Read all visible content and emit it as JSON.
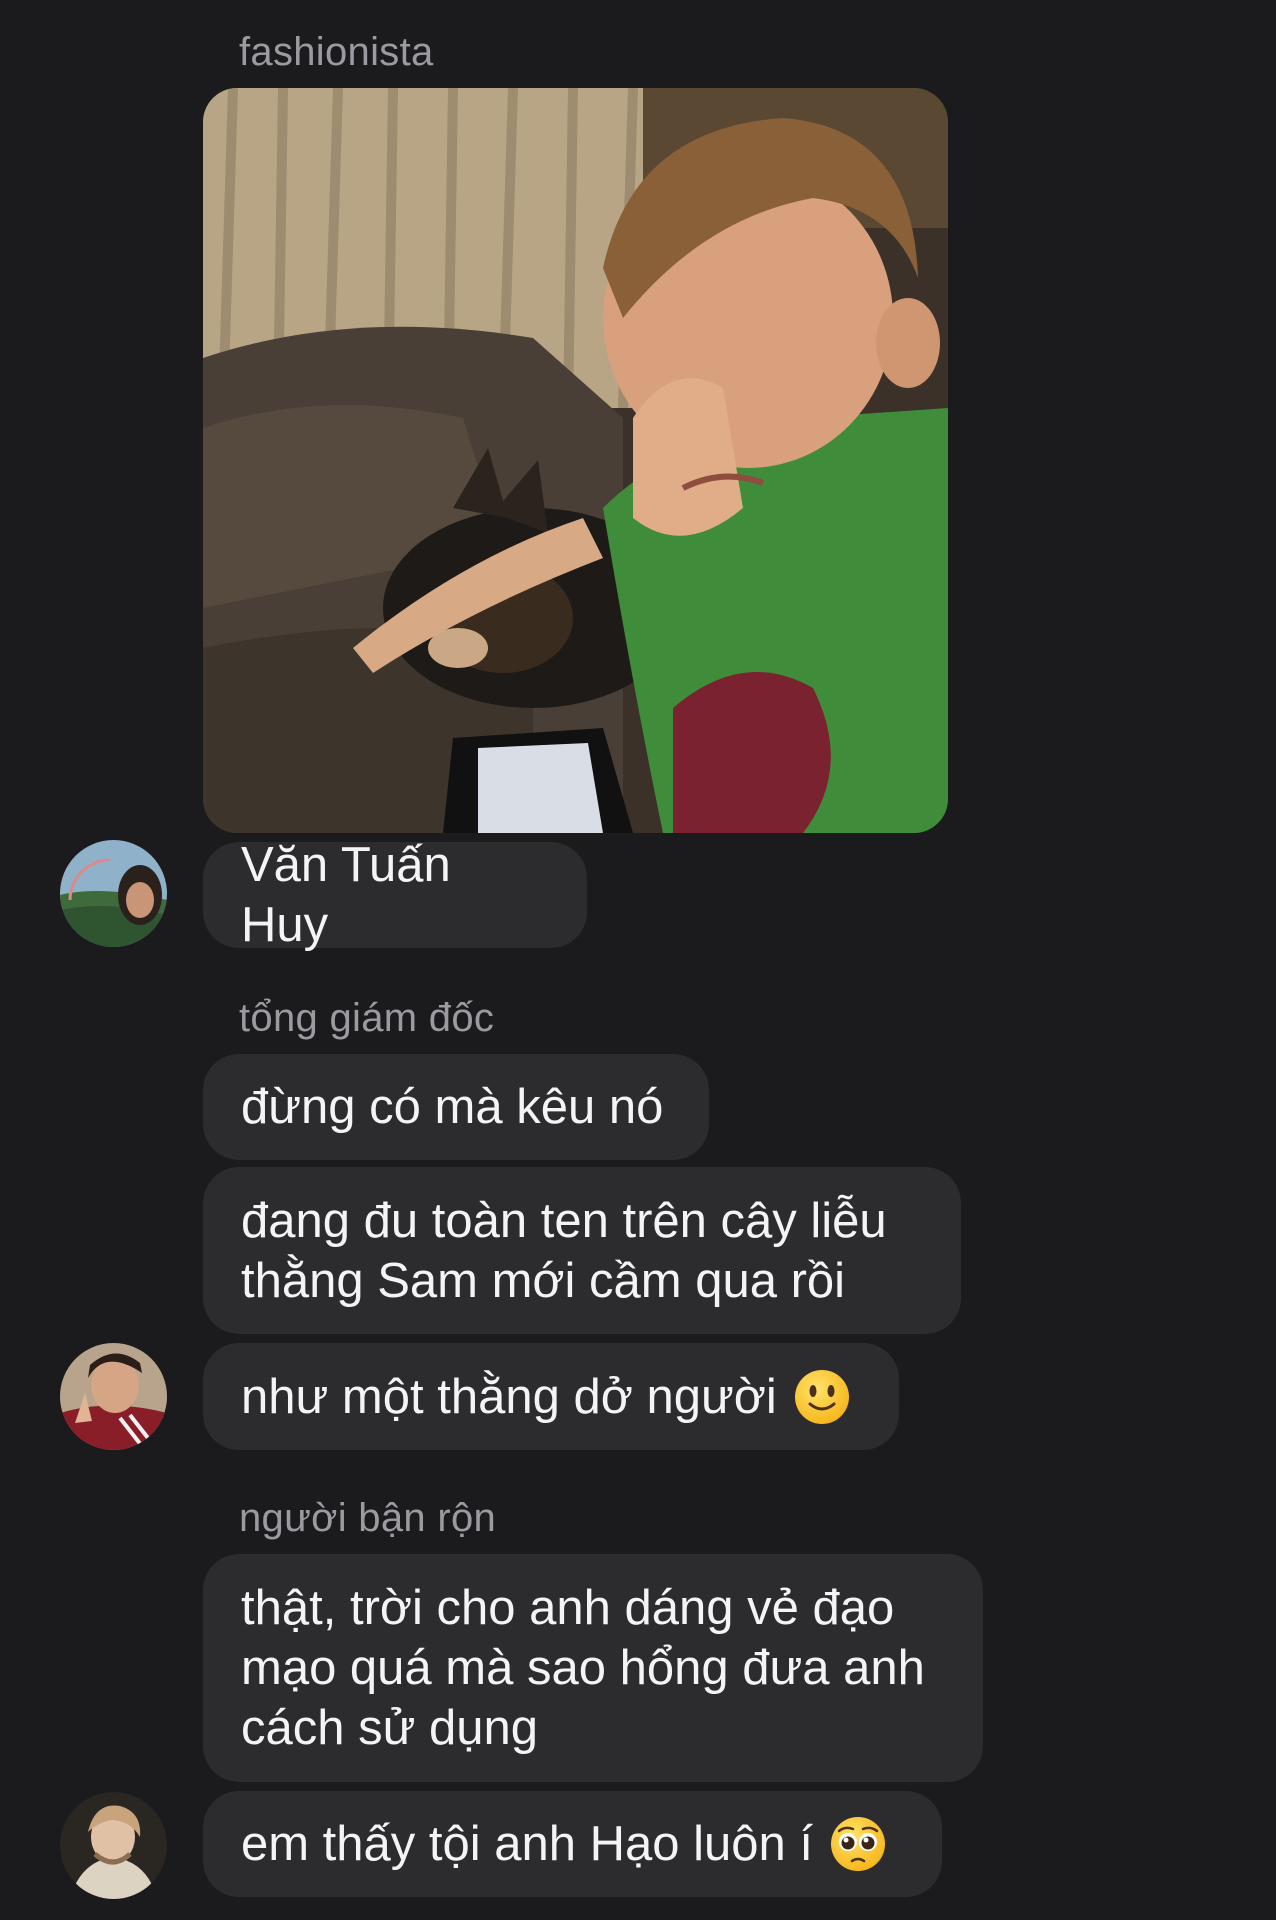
{
  "messages": {
    "group1": {
      "sender": "fashionista",
      "photo_description": "crying-child-with-dog-photo",
      "text": "Văn Tuấn Huy"
    },
    "group2": {
      "sender": "tổng giám đốc",
      "texts": [
        "đừng có mà kêu nó",
        "đang đu toàn ten trên cây liễu\nthằng Sam mới cầm qua rồi",
        "như một thằng dở người"
      ],
      "emoji": "slightly-smiling-face"
    },
    "group3": {
      "sender": "người bận rộn",
      "texts": [
        "thật, trời cho anh dáng vẻ đạo\nmạo quá mà sao hổng đưa anh\ncách sử dụng",
        "em thấy tội anh Hạo luôn í"
      ],
      "emoji": "pleading-face"
    }
  },
  "colors": {
    "background": "#1b1b1e",
    "bubble": "#2c2c2f",
    "sender_name": "#9a9aa1",
    "text": "#f4f4f6"
  }
}
